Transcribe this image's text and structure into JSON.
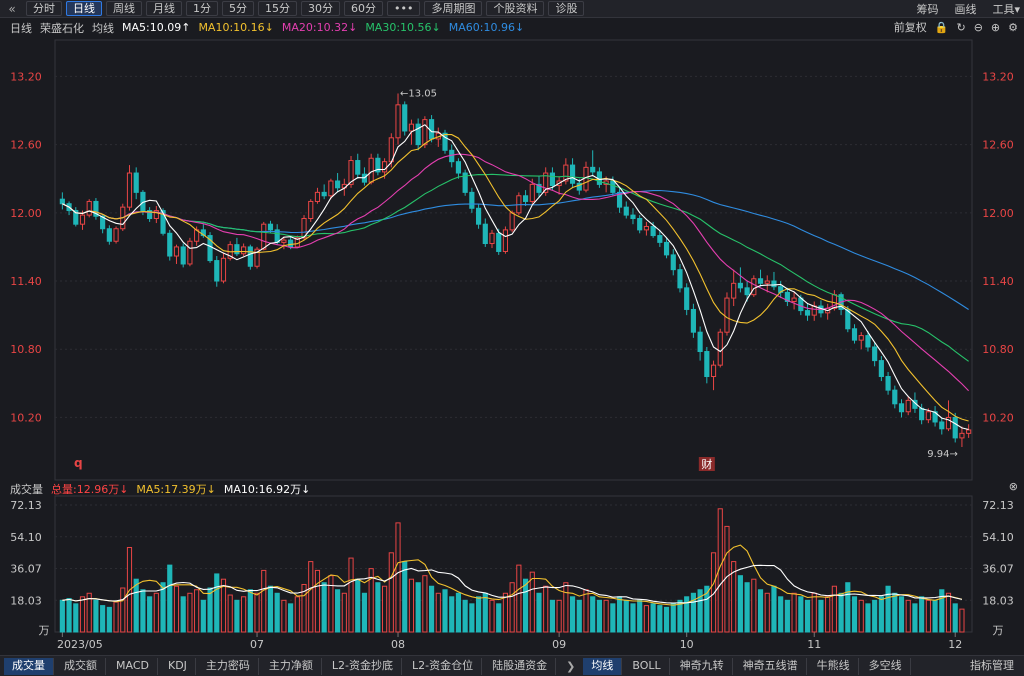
{
  "toolbar": {
    "back": "«",
    "tabs": [
      "分时",
      "日线",
      "周线",
      "月线",
      "1分",
      "5分",
      "15分",
      "30分",
      "60分",
      "•••",
      "多周期图",
      "个股资料",
      "诊股"
    ],
    "active_tab": 1,
    "right": [
      "筹码",
      "画线",
      "工具▾"
    ]
  },
  "main_legend": {
    "period": "日线",
    "name": "荣盛石化",
    "avg_label": "均线",
    "ma5": "MA5:10.09↑",
    "ma10": "MA10:10.16↓",
    "ma20": "MA20:10.32↓",
    "ma30": "MA30:10.56↓",
    "ma60": "MA60:10.96↓",
    "right": "前复权"
  },
  "vol_legend": {
    "title": "成交量",
    "total": "总量:12.96万↓",
    "ma5": "MA5:17.39万↓",
    "ma10": "MA10:16.92万↓"
  },
  "colors": {
    "up": "#e84545",
    "down": "#1fb6b8",
    "ma5": "#ffffff",
    "ma10": "#f2c12e",
    "ma20": "#e43fb0",
    "ma30": "#27c26a",
    "ma60": "#2f8ce0"
  },
  "annotations": {
    "high": "13.05",
    "low": "9.94",
    "marker_q": "q",
    "marker_cai": "财"
  },
  "chart_data": {
    "type": "candlestick",
    "price_axis": [
      "13.20",
      "12.60",
      "12.00",
      "11.40",
      "10.80",
      "10.20"
    ],
    "vol_axis": [
      "72.13",
      "54.10",
      "36.07",
      "18.03",
      "万"
    ],
    "price_ylim": [
      9.72,
      13.45
    ],
    "vol_ylim": [
      0,
      75
    ],
    "x_labels": [
      "2023/05",
      "07",
      "08",
      "09",
      "10",
      "11",
      "12"
    ],
    "x_label_index": [
      0,
      29,
      50,
      74,
      93,
      112,
      133
    ],
    "candles": [
      [
        12.12,
        12.18,
        12.03,
        12.08
      ],
      [
        12.08,
        12.1,
        11.98,
        12.02
      ],
      [
        12.02,
        12.05,
        11.88,
        11.9
      ],
      [
        11.9,
        12.02,
        11.85,
        11.98
      ],
      [
        11.98,
        12.12,
        11.96,
        12.1
      ],
      [
        12.1,
        12.13,
        11.94,
        11.97
      ],
      [
        11.97,
        11.98,
        11.82,
        11.86
      ],
      [
        11.86,
        11.89,
        11.72,
        11.75
      ],
      [
        11.75,
        11.88,
        11.73,
        11.86
      ],
      [
        11.86,
        12.08,
        11.84,
        12.05
      ],
      [
        12.05,
        12.42,
        12.02,
        12.35
      ],
      [
        12.35,
        12.4,
        12.12,
        12.18
      ],
      [
        12.18,
        12.2,
        11.98,
        12.02
      ],
      [
        12.02,
        12.05,
        11.92,
        11.95
      ],
      [
        11.95,
        12.06,
        11.91,
        12.02
      ],
      [
        12.02,
        12.04,
        11.8,
        11.82
      ],
      [
        11.82,
        11.85,
        11.58,
        11.62
      ],
      [
        11.62,
        11.72,
        11.55,
        11.7
      ],
      [
        11.7,
        11.73,
        11.52,
        11.55
      ],
      [
        11.55,
        11.78,
        11.53,
        11.75
      ],
      [
        11.75,
        11.88,
        11.71,
        11.85
      ],
      [
        11.85,
        11.9,
        11.78,
        11.8
      ],
      [
        11.8,
        11.83,
        11.56,
        11.58
      ],
      [
        11.58,
        11.62,
        11.35,
        11.4
      ],
      [
        11.4,
        11.65,
        11.38,
        11.6
      ],
      [
        11.6,
        11.75,
        11.58,
        11.72
      ],
      [
        11.72,
        11.78,
        11.62,
        11.64
      ],
      [
        11.64,
        11.73,
        11.62,
        11.7
      ],
      [
        11.7,
        11.72,
        11.5,
        11.53
      ],
      [
        11.53,
        11.7,
        11.51,
        11.68
      ],
      [
        11.68,
        11.92,
        11.67,
        11.9
      ],
      [
        11.9,
        11.93,
        11.82,
        11.85
      ],
      [
        11.85,
        11.9,
        11.72,
        11.74
      ],
      [
        11.74,
        11.79,
        11.68,
        11.76
      ],
      [
        11.76,
        11.8,
        11.68,
        11.7
      ],
      [
        11.7,
        11.8,
        11.69,
        11.78
      ],
      [
        11.78,
        11.98,
        11.76,
        11.95
      ],
      [
        11.95,
        12.12,
        11.92,
        12.1
      ],
      [
        12.1,
        12.22,
        12.08,
        12.18
      ],
      [
        12.18,
        12.25,
        12.12,
        12.15
      ],
      [
        12.15,
        12.3,
        12.12,
        12.28
      ],
      [
        12.28,
        12.35,
        12.18,
        12.22
      ],
      [
        12.22,
        12.3,
        12.15,
        12.25
      ],
      [
        12.25,
        12.5,
        12.22,
        12.46
      ],
      [
        12.46,
        12.52,
        12.3,
        12.34
      ],
      [
        12.34,
        12.4,
        12.24,
        12.27
      ],
      [
        12.27,
        12.52,
        12.25,
        12.48
      ],
      [
        12.48,
        12.52,
        12.33,
        12.36
      ],
      [
        12.36,
        12.48,
        12.3,
        12.45
      ],
      [
        12.45,
        12.7,
        12.4,
        12.66
      ],
      [
        12.66,
        13.05,
        12.6,
        12.95
      ],
      [
        12.95,
        12.98,
        12.68,
        12.72
      ],
      [
        12.72,
        12.82,
        12.6,
        12.78
      ],
      [
        12.78,
        12.83,
        12.55,
        12.6
      ],
      [
        12.6,
        12.85,
        12.57,
        12.82
      ],
      [
        12.82,
        12.86,
        12.62,
        12.65
      ],
      [
        12.65,
        12.75,
        12.58,
        12.7
      ],
      [
        12.7,
        12.73,
        12.52,
        12.55
      ],
      [
        12.55,
        12.6,
        12.4,
        12.45
      ],
      [
        12.45,
        12.48,
        12.3,
        12.35
      ],
      [
        12.35,
        12.38,
        12.15,
        12.18
      ],
      [
        12.18,
        12.22,
        12.0,
        12.04
      ],
      [
        12.04,
        12.08,
        11.86,
        11.9
      ],
      [
        11.9,
        11.95,
        11.7,
        11.73
      ],
      [
        11.73,
        11.85,
        11.69,
        11.82
      ],
      [
        11.82,
        11.86,
        11.63,
        11.66
      ],
      [
        11.66,
        11.88,
        11.64,
        11.85
      ],
      [
        11.85,
        12.02,
        11.83,
        12.0
      ],
      [
        12.0,
        12.18,
        11.98,
        12.15
      ],
      [
        12.15,
        12.2,
        12.06,
        12.1
      ],
      [
        12.1,
        12.3,
        12.08,
        12.25
      ],
      [
        12.25,
        12.32,
        12.14,
        12.18
      ],
      [
        12.18,
        12.4,
        12.15,
        12.35
      ],
      [
        12.35,
        12.4,
        12.2,
        12.24
      ],
      [
        12.24,
        12.32,
        12.16,
        12.28
      ],
      [
        12.28,
        12.48,
        12.25,
        12.42
      ],
      [
        12.42,
        12.48,
        12.22,
        12.26
      ],
      [
        12.26,
        12.3,
        12.16,
        12.2
      ],
      [
        12.2,
        12.45,
        12.18,
        12.4
      ],
      [
        12.4,
        12.55,
        12.32,
        12.36
      ],
      [
        12.36,
        12.4,
        12.22,
        12.25
      ],
      [
        12.25,
        12.32,
        12.18,
        12.28
      ],
      [
        12.28,
        12.32,
        12.15,
        12.18
      ],
      [
        12.18,
        12.22,
        12.0,
        12.05
      ],
      [
        12.05,
        12.1,
        11.95,
        11.98
      ],
      [
        11.98,
        12.04,
        11.9,
        11.95
      ],
      [
        11.95,
        11.98,
        11.82,
        11.85
      ],
      [
        11.85,
        11.92,
        11.8,
        11.88
      ],
      [
        11.88,
        11.92,
        11.78,
        11.8
      ],
      [
        11.8,
        11.85,
        11.7,
        11.74
      ],
      [
        11.74,
        11.78,
        11.6,
        11.63
      ],
      [
        11.63,
        11.68,
        11.45,
        11.5
      ],
      [
        11.5,
        11.55,
        11.3,
        11.34
      ],
      [
        11.34,
        11.38,
        11.1,
        11.15
      ],
      [
        11.15,
        11.2,
        10.9,
        10.95
      ],
      [
        10.95,
        11.0,
        10.7,
        10.78
      ],
      [
        10.78,
        10.82,
        10.5,
        10.56
      ],
      [
        10.56,
        10.7,
        10.44,
        10.66
      ],
      [
        10.66,
        10.98,
        10.64,
        10.95
      ],
      [
        10.95,
        11.3,
        10.92,
        11.25
      ],
      [
        11.25,
        11.5,
        11.18,
        11.38
      ],
      [
        11.38,
        11.52,
        11.3,
        11.34
      ],
      [
        11.34,
        11.4,
        11.22,
        11.28
      ],
      [
        11.28,
        11.45,
        11.26,
        11.42
      ],
      [
        11.42,
        11.5,
        11.35,
        11.38
      ],
      [
        11.38,
        11.45,
        11.3,
        11.4
      ],
      [
        11.4,
        11.48,
        11.32,
        11.35
      ],
      [
        11.35,
        11.4,
        11.25,
        11.3
      ],
      [
        11.3,
        11.34,
        11.18,
        11.22
      ],
      [
        11.22,
        11.3,
        11.15,
        11.25
      ],
      [
        11.25,
        11.28,
        11.1,
        11.14
      ],
      [
        11.14,
        11.2,
        11.05,
        11.1
      ],
      [
        11.1,
        11.22,
        11.05,
        11.18
      ],
      [
        11.18,
        11.23,
        11.08,
        11.12
      ],
      [
        11.12,
        11.2,
        11.06,
        11.16
      ],
      [
        11.16,
        11.32,
        11.14,
        11.28
      ],
      [
        11.28,
        11.3,
        11.1,
        11.15
      ],
      [
        11.15,
        11.18,
        10.95,
        10.98
      ],
      [
        10.98,
        11.02,
        10.85,
        10.88
      ],
      [
        10.88,
        10.95,
        10.8,
        10.92
      ],
      [
        10.92,
        10.96,
        10.78,
        10.82
      ],
      [
        10.82,
        10.86,
        10.65,
        10.7
      ],
      [
        10.7,
        10.74,
        10.52,
        10.56
      ],
      [
        10.56,
        10.6,
        10.4,
        10.44
      ],
      [
        10.44,
        10.48,
        10.28,
        10.32
      ],
      [
        10.32,
        10.36,
        10.2,
        10.25
      ],
      [
        10.25,
        10.38,
        10.22,
        10.35
      ],
      [
        10.35,
        10.42,
        10.24,
        10.28
      ],
      [
        10.28,
        10.32,
        10.14,
        10.18
      ],
      [
        10.18,
        10.28,
        10.15,
        10.25
      ],
      [
        10.25,
        10.3,
        10.12,
        10.16
      ],
      [
        10.16,
        10.2,
        10.05,
        10.1
      ],
      [
        10.1,
        10.35,
        10.08,
        10.2
      ],
      [
        10.2,
        10.24,
        9.98,
        10.02
      ],
      [
        10.02,
        10.12,
        9.94,
        10.06
      ],
      [
        10.06,
        10.14,
        10.02,
        10.09
      ]
    ],
    "volume": [
      18,
      19,
      16,
      20,
      22,
      18,
      15,
      14,
      17,
      25,
      48,
      30,
      24,
      20,
      22,
      28,
      38,
      26,
      20,
      22,
      24,
      18,
      25,
      33,
      30,
      21,
      18,
      20,
      24,
      22,
      35,
      26,
      22,
      18,
      16,
      20,
      27,
      40,
      35,
      28,
      32,
      24,
      22,
      42,
      30,
      22,
      36,
      28,
      26,
      45,
      62,
      40,
      30,
      28,
      32,
      26,
      22,
      24,
      20,
      22,
      18,
      16,
      20,
      22,
      18,
      16,
      22,
      28,
      38,
      30,
      34,
      22,
      26,
      18,
      18,
      28,
      20,
      18,
      24,
      20,
      18,
      18,
      16,
      20,
      18,
      16,
      18,
      15,
      16,
      15,
      14,
      16,
      18,
      20,
      22,
      24,
      26,
      45,
      70,
      60,
      40,
      32,
      28,
      30,
      24,
      22,
      26,
      20,
      18,
      22,
      20,
      18,
      22,
      18,
      20,
      26,
      22,
      28,
      20,
      18,
      16,
      18,
      20,
      26,
      22,
      20,
      18,
      16,
      20,
      18,
      18,
      24,
      22,
      16,
      13
    ]
  }
}
